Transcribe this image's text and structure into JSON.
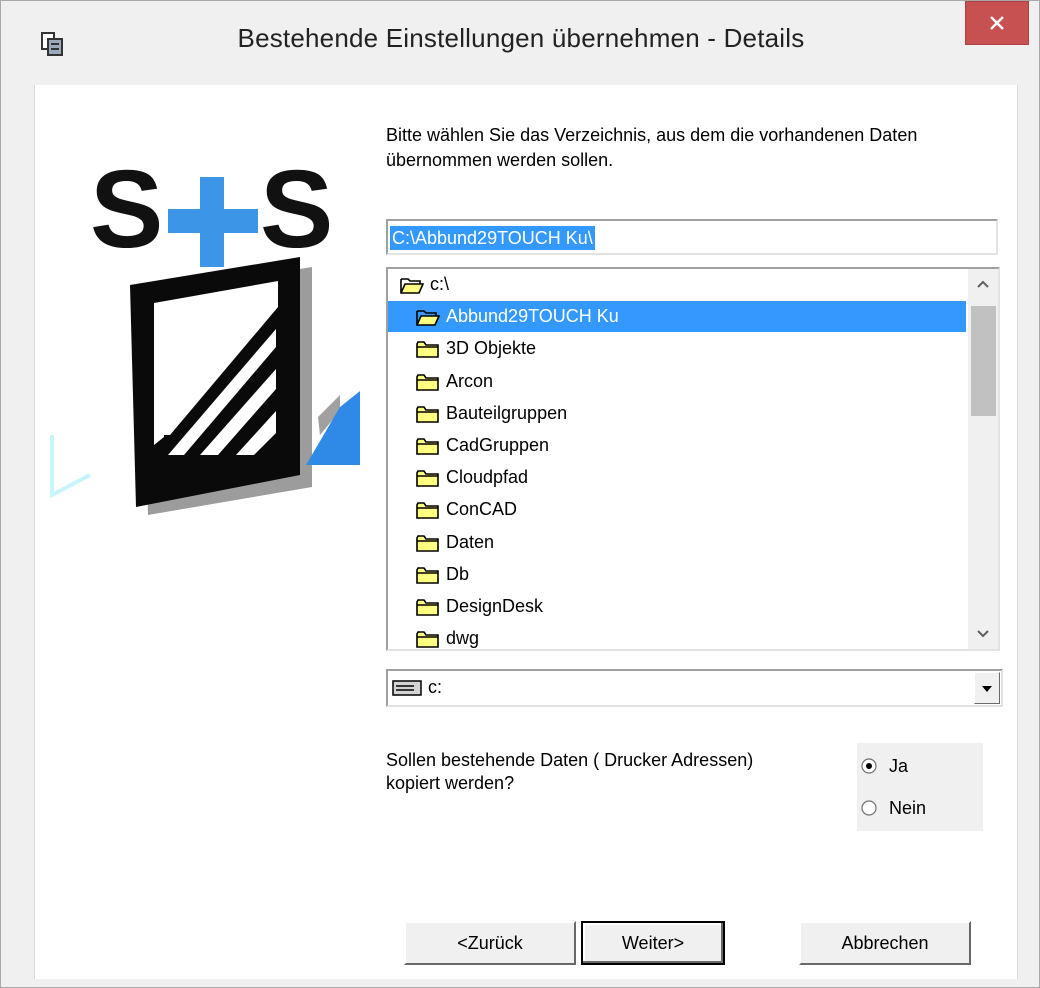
{
  "window": {
    "title": "Bestehende Einstellungen übernehmen - Details",
    "close_symbol": "×"
  },
  "instruction": "Bitte wählen Sie das Verzeichnis, aus dem die vorhandenen Daten übernommen werden sollen.",
  "path_input": {
    "value": "C:\\Abbund29TOUCH Ku\\"
  },
  "directory_list": {
    "items": [
      {
        "label": "c:\\",
        "icon": "open-folder-icon",
        "level": 0,
        "selected": false
      },
      {
        "label": "Abbund29TOUCH Ku",
        "icon": "open-folder-icon",
        "level": 1,
        "selected": true
      },
      {
        "label": "3D Objekte",
        "icon": "folder-icon",
        "level": 2,
        "selected": false
      },
      {
        "label": "Arcon",
        "icon": "folder-icon",
        "level": 2,
        "selected": false
      },
      {
        "label": "Bauteilgruppen",
        "icon": "folder-icon",
        "level": 2,
        "selected": false
      },
      {
        "label": "CadGruppen",
        "icon": "folder-icon",
        "level": 2,
        "selected": false
      },
      {
        "label": "Cloudpfad",
        "icon": "folder-icon",
        "level": 2,
        "selected": false
      },
      {
        "label": "ConCAD",
        "icon": "folder-icon",
        "level": 2,
        "selected": false
      },
      {
        "label": "Daten",
        "icon": "folder-icon",
        "level": 2,
        "selected": false
      },
      {
        "label": "Db",
        "icon": "folder-icon",
        "level": 2,
        "selected": false
      },
      {
        "label": "DesignDesk",
        "icon": "folder-icon",
        "level": 2,
        "selected": false
      },
      {
        "label": "dwg",
        "icon": "folder-icon",
        "level": 2,
        "selected": false
      }
    ]
  },
  "drive_select": {
    "value": "c:"
  },
  "question": "Sollen bestehende Daten ( Drucker Adressen) kopiert werden?",
  "radio_options": [
    {
      "label": "Ja",
      "checked": true
    },
    {
      "label": "Nein",
      "checked": false
    }
  ],
  "buttons": {
    "back": "<Zurück",
    "next": "Weiter>",
    "cancel": "Abbrechen"
  },
  "colors": {
    "selection": "#3399ff",
    "close_button": "#c75050",
    "logo_blue": "#2e8ae6",
    "folder_yellow": "#ffff80"
  }
}
